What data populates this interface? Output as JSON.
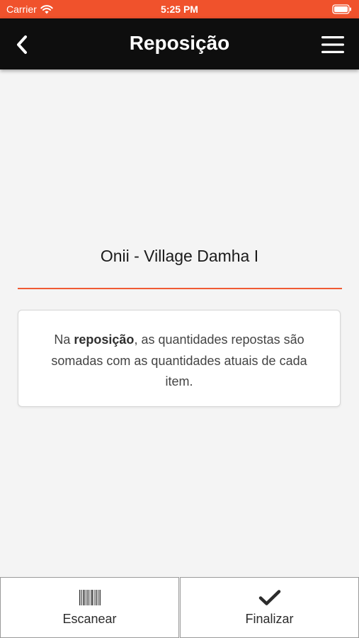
{
  "status_bar": {
    "carrier": "Carrier",
    "time": "5:25 PM",
    "icons": [
      "wifi-icon",
      "battery-icon"
    ],
    "background": "#f0522c"
  },
  "header": {
    "title": "Reposição",
    "back_icon": "chevron-left-icon",
    "menu_icon": "hamburger-menu-icon",
    "background": "#0e0e0e"
  },
  "main": {
    "store_name": "Onii - Village Damha I",
    "accent_color": "#ef5a33",
    "info": {
      "prefix": "Na ",
      "bold": "reposição",
      "suffix": ", as quantidades repostas são somadas com as quantidades atuais de cada item."
    }
  },
  "footer": {
    "buttons": [
      {
        "label": "Escanear",
        "icon": "barcode-icon"
      },
      {
        "label": "Finalizar",
        "icon": "checkmark-icon"
      }
    ]
  }
}
